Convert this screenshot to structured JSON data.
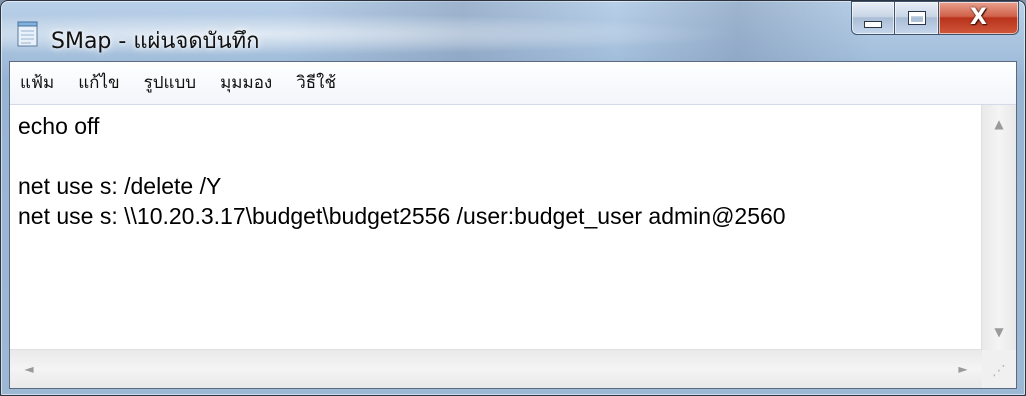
{
  "window": {
    "title": "SMap - แผ่นจดบันทึก",
    "app_icon": "notepad-icon",
    "controls": {
      "minimize_icon": "minimize-icon",
      "maximize_icon": "maximize-icon",
      "close_icon": "close-icon",
      "close_glyph": "X"
    }
  },
  "menu": {
    "items": [
      {
        "label": "แฟ้ม"
      },
      {
        "label": "แก้ไข"
      },
      {
        "label": "รูปแบบ"
      },
      {
        "label": "มุมมอง"
      },
      {
        "label": "วิธีใช้"
      }
    ]
  },
  "editor": {
    "lines": [
      "echo off",
      "",
      "net use s: /delete /Y",
      "net use s: \\\\10.20.3.17\\budget\\budget2556 /user:budget_user admin@2560"
    ]
  },
  "scrollbars": {
    "up_glyph": "▲",
    "down_glyph": "▼",
    "left_glyph": "◄",
    "right_glyph": "►",
    "grip_glyph": "⋰"
  }
}
